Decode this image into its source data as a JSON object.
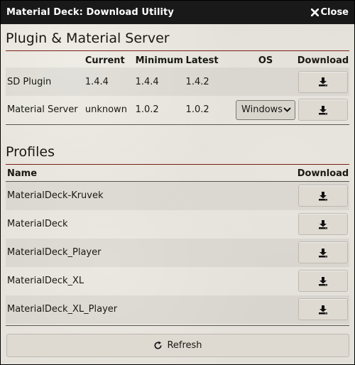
{
  "window": {
    "title": "Material Deck: Download Utility",
    "close_label": "Close"
  },
  "plugin_section": {
    "title": "Plugin & Material Server",
    "headers": {
      "name": "",
      "current": "Current",
      "minimum": "Minimum",
      "latest": "Latest",
      "os": "OS",
      "download": "Download"
    },
    "rows": [
      {
        "name": "SD Plugin",
        "current": "1.4.4",
        "minimum": "1.4.4",
        "latest": "1.4.2",
        "os": ""
      },
      {
        "name": "Material Server",
        "current": "unknown",
        "minimum": "1.0.2",
        "latest": "1.0.2",
        "os": "Windows"
      }
    ]
  },
  "profiles_section": {
    "title": "Profiles",
    "headers": {
      "name": "Name",
      "download": "Download"
    },
    "rows": [
      {
        "name": "MaterialDeck-Kruvek"
      },
      {
        "name": "MaterialDeck"
      },
      {
        "name": "MaterialDeck_Player"
      },
      {
        "name": "MaterialDeck_XL"
      },
      {
        "name": "MaterialDeck_XL_Player"
      }
    ]
  },
  "refresh_label": "Refresh",
  "icons": {
    "close": "close-icon",
    "download": "download-icon",
    "refresh": "refresh-icon",
    "select_arrow": "chevron-down-icon"
  },
  "colors": {
    "titlebar": "#191919",
    "accent_rule": "#7a1f12",
    "background": "#e4e1da"
  }
}
